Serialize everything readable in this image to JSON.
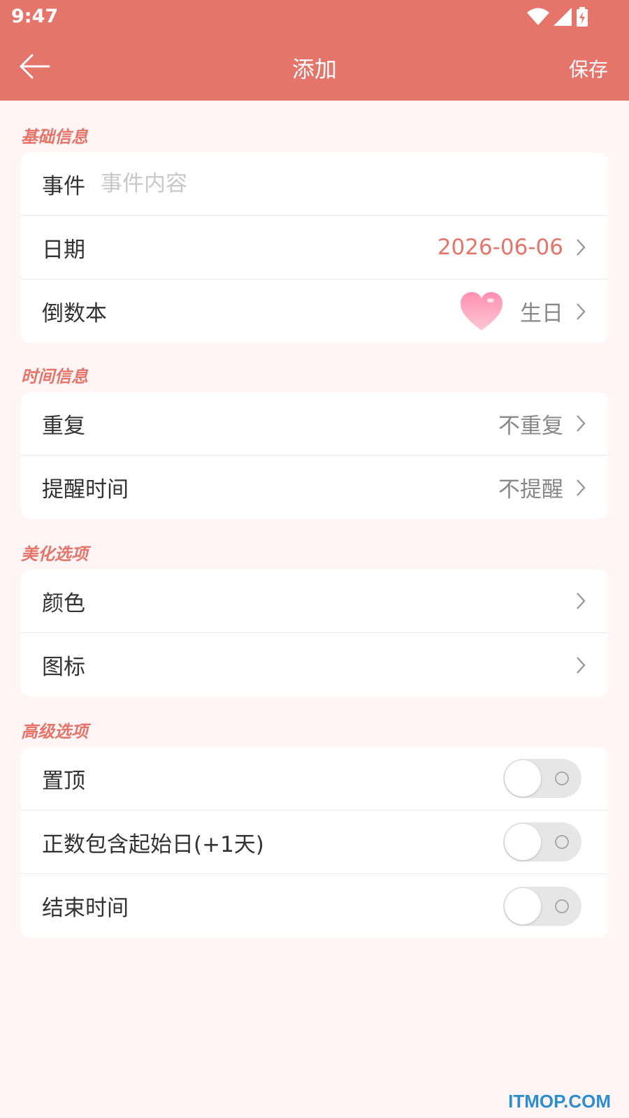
{
  "status": {
    "time": "9:47"
  },
  "appbar": {
    "title": "添加",
    "save_label": "保存"
  },
  "sections": {
    "basic": "基础信息",
    "time": "时间信息",
    "beautify": "美化选项",
    "advanced": "高级选项"
  },
  "basic": {
    "event_label": "事件",
    "event_placeholder": "事件内容",
    "event_value": "",
    "date_label": "日期",
    "date_value": "2026-06-06",
    "book_label": "倒数本",
    "book_value": "生日",
    "book_icon": "heart-icon"
  },
  "time": {
    "repeat_label": "重复",
    "repeat_value": "不重复",
    "remind_label": "提醒时间",
    "remind_value": "不提醒"
  },
  "beautify": {
    "color_label": "颜色",
    "icon_label": "图标"
  },
  "advanced": {
    "pin_label": "置顶",
    "pin_on": false,
    "include_start_label": "正数包含起始日(+1天)",
    "include_start_on": false,
    "end_time_label": "结束时间",
    "end_time_on": false
  },
  "watermark": "ITMOP.COM",
  "colors": {
    "accent": "#e5756a",
    "background": "#fff5f5"
  }
}
